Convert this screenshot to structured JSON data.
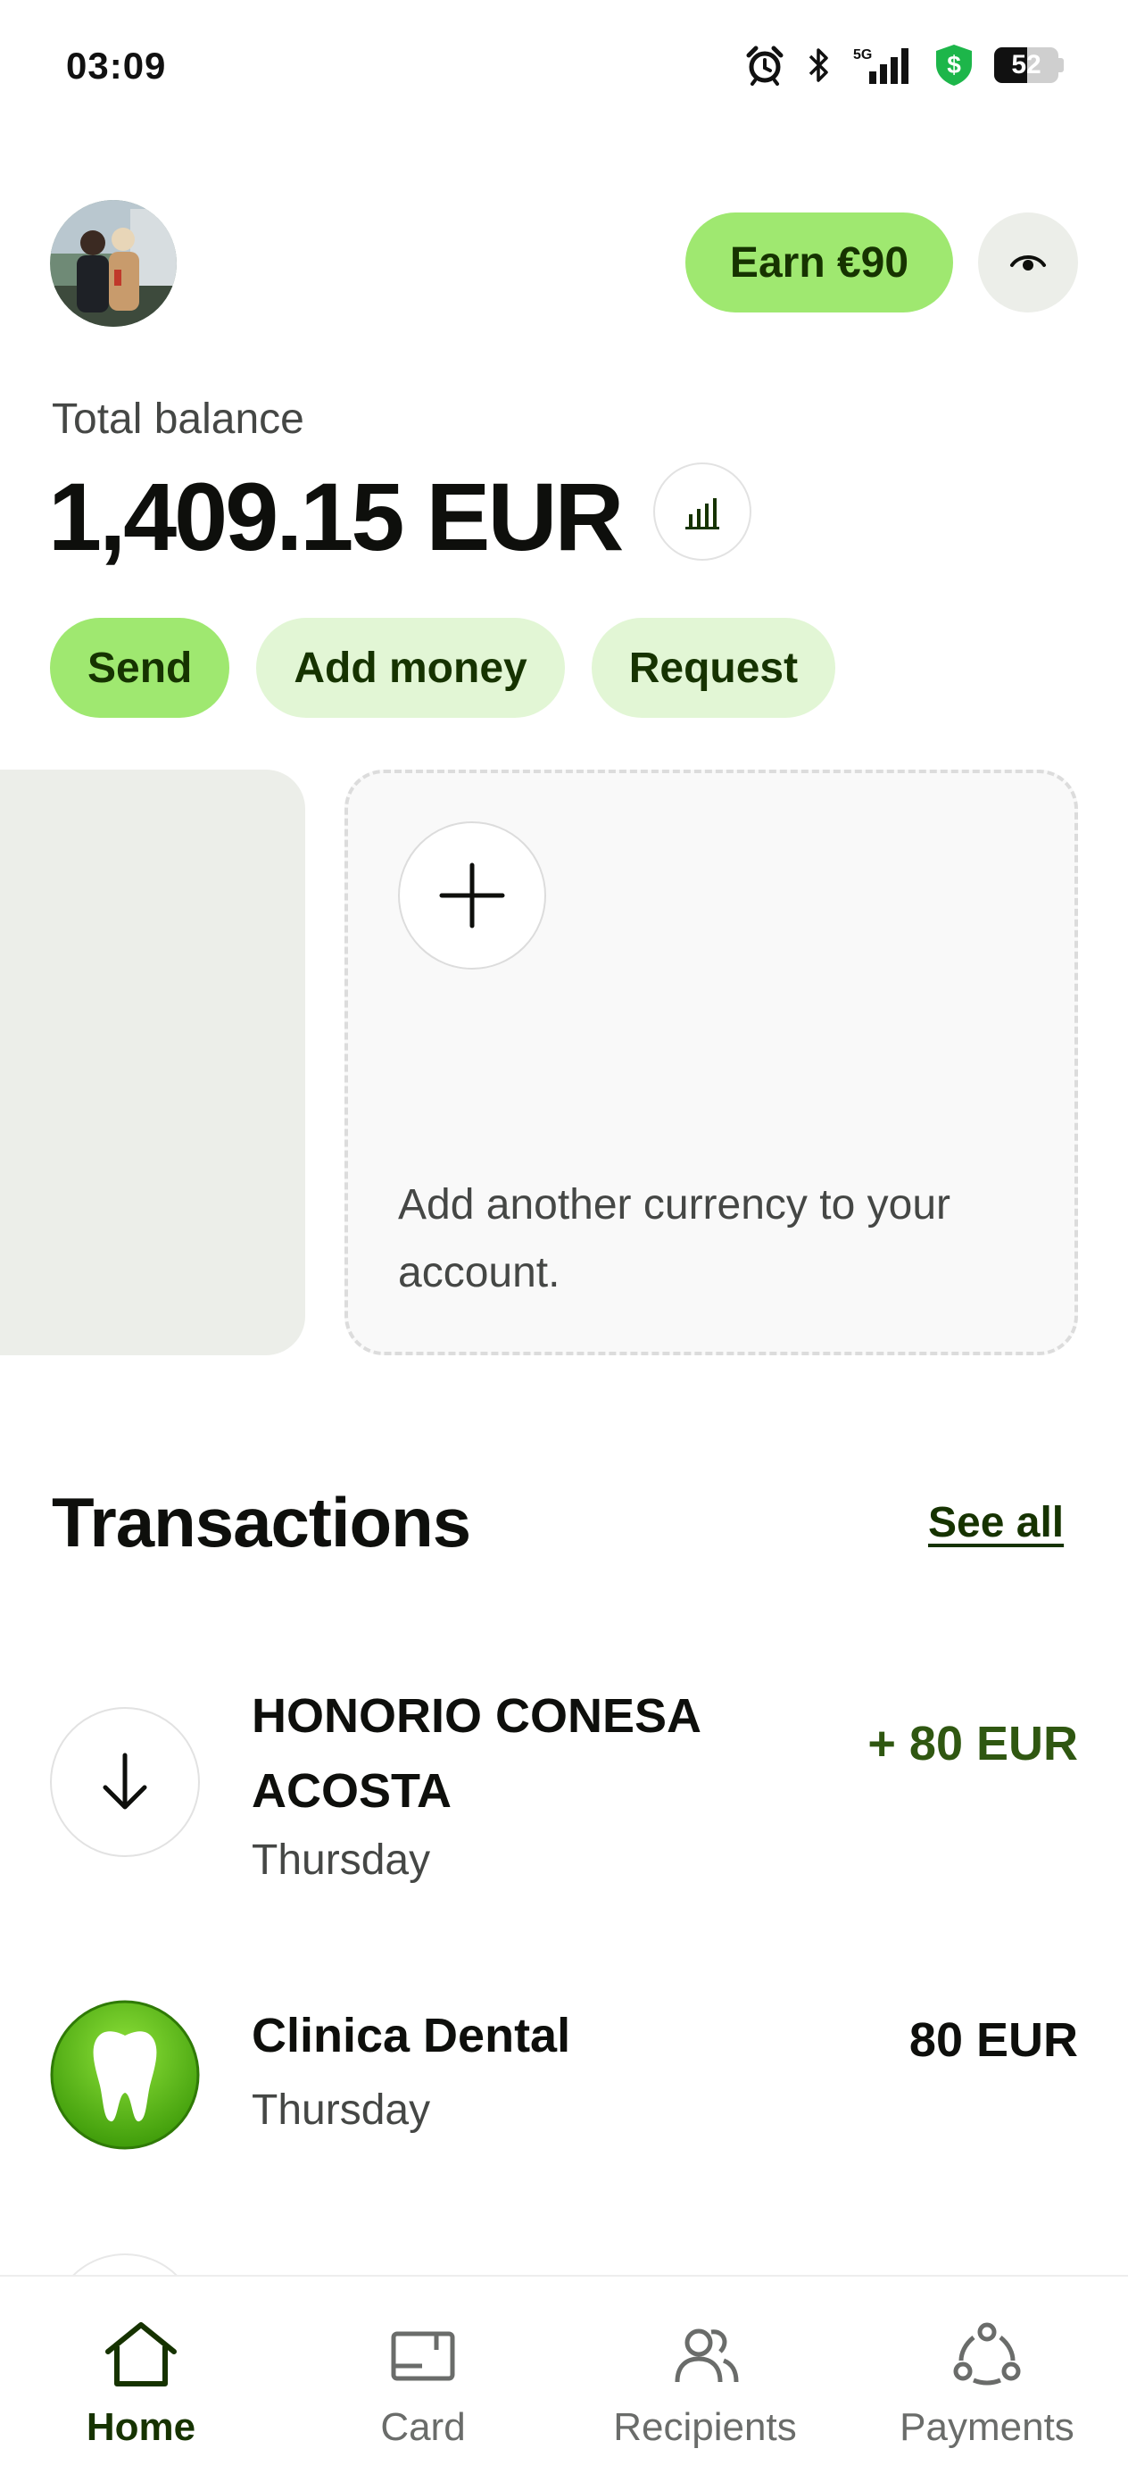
{
  "status_bar": {
    "time": "03:09",
    "network": "5G",
    "battery_level": "52",
    "battery_percent": 52,
    "icons": [
      "alarm-icon",
      "bluetooth-icon",
      "signal-5g-icon",
      "vpn-shield-icon",
      "battery-icon"
    ]
  },
  "header": {
    "avatar_icon": "profile-avatar",
    "earn_label": "Earn €90",
    "eye_icon": "eye-icon"
  },
  "balance": {
    "label": "Total balance",
    "amount": "1,409.15 EUR",
    "insights_icon": "bar-chart-icon"
  },
  "actions": {
    "send": "Send",
    "add_money": "Add money",
    "request": "Request"
  },
  "cards": {
    "add_currency_text": "Add another currency to your account.",
    "plus_icon": "plus-icon"
  },
  "transactions": {
    "title": "Transactions",
    "see_all": "See all",
    "items": [
      {
        "name": "HONORIO CONESA ACOSTA",
        "date": "Thursday",
        "amount": "+ 80 EUR",
        "icon": "arrow-down-icon"
      },
      {
        "name": "Clinica Dental",
        "date": "Thursday",
        "amount": "80 EUR",
        "icon": "tooth-icon"
      }
    ]
  },
  "bottom_nav": {
    "items": [
      {
        "label": "Home",
        "icon": "home-icon",
        "active": true
      },
      {
        "label": "Card",
        "icon": "card-icon",
        "active": false
      },
      {
        "label": "Recipients",
        "icon": "recipients-icon",
        "active": false
      },
      {
        "label": "Payments",
        "icon": "payments-icon",
        "active": false
      }
    ]
  },
  "colors": {
    "accent_green": "#9fe870",
    "accent_light_green": "#e2f6d5",
    "forest_green": "#163300",
    "positive_amount": "#2f5711"
  }
}
